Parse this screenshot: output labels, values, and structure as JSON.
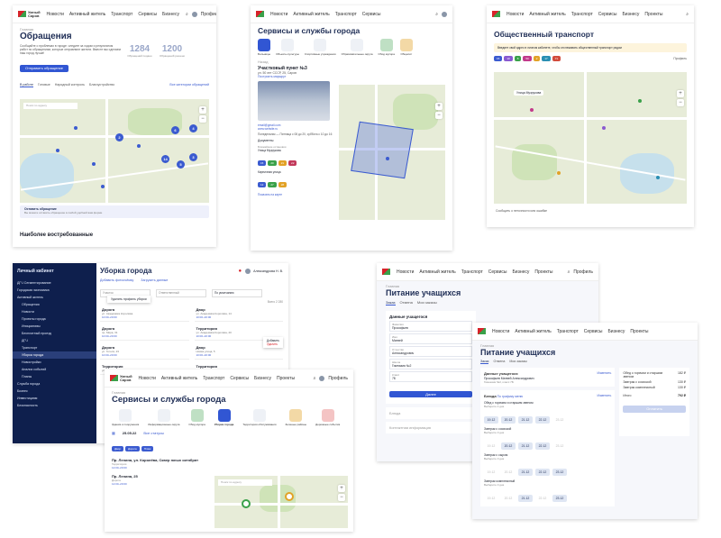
{
  "logo": {
    "line1": "Умный",
    "line2": "Саров"
  },
  "nav": {
    "news": "Новости",
    "active": "Активный житель",
    "transport": "Транспорт",
    "services": "Сервисы",
    "business": "Бизнесу",
    "projects": "Проекты",
    "profile": "Профиль",
    "home": "Главная"
  },
  "obr": {
    "title": "Обращения",
    "desc": "Сообщайте о проблемах в городе: следите за ходом и результатом работ по обращениям, которые отправляют жители. Вместе мы сделаем наш город лучше!",
    "count1": "1284",
    "count1_lbl": "Обращений подано",
    "count2": "1200",
    "count2_lbl": "Обращений решено",
    "send": "Отправить обращение",
    "tabs": [
      "В работе",
      "Готовые",
      "Народный контроль",
      "Благоустройство"
    ],
    "all": "Все категории обращений",
    "search": "Поиск по адресу",
    "popular": "Наиболее востребованные",
    "banner": "Оставить обращение",
    "banner_sub": "Вы можете оставить обращение в любой удобной вам форме",
    "clusters": [
      "2",
      "6",
      "3",
      "5",
      "14",
      "4"
    ]
  },
  "svc": {
    "title": "Сервисы и службы города",
    "tiles": [
      "Больницы",
      "Объекты культуры",
      "Спортивные учреждения",
      "Образовательные округа",
      "Обод мусора",
      "Общепит"
    ],
    "back": "Назад",
    "unit": "Участковый пункт №3",
    "addr": "ул. 50 лет СССР, 25, Саров",
    "route": "Построить маршрут",
    "email": "email@gmail.com",
    "site": "www.website.ru",
    "hours": "Понедельник — Пятница с 08 до 20, суббота с 10 до 16",
    "docs": "Документы",
    "lines": "Ближайшие остановки",
    "stop1": "Улица Музрукова",
    "stop2": "Кирпичная улица",
    "show": "Показать на карте",
    "chips1": [
      "15",
      "20",
      "21",
      "22"
    ],
    "chips2": [
      "12",
      "27",
      "28"
    ]
  },
  "tr": {
    "title": "Общественный транспорт",
    "notice": "Введите свой адрес в личном кабинете, чтобы отслеживать общественный транспорт рядом",
    "profile": "Профиль",
    "routes": [
      "15",
      "10",
      "8",
      "50",
      "2",
      "17",
      "71"
    ],
    "label": "Улица Музрукова",
    "footer": "Сообщить о неточности или ошибке"
  },
  "lk": {
    "title": "Личный кабинет",
    "section": "Уборка города",
    "items": [
      "ДГЧ Сегментирование",
      "Городская экономика",
      "Активный житель",
      "Обращения",
      "Новости",
      "Проекты города",
      "Инициативы",
      "Бесплатный проезд",
      "ДГЧ",
      "Транспорт",
      "Уборка города",
      "Новостройки",
      "Анализ событий",
      "Планы",
      "Служба города",
      "Бизнес",
      "Инвестициям",
      "Безопасность"
    ],
    "add": "Добавить фотосъёмку",
    "load": "Загрузить данные",
    "user": "Александрова Н. В.",
    "menu_item": "Удалить профиль уборки",
    "filter1": "Участок",
    "filter2": "Ответственный",
    "filter3": "Последовательность",
    "sort": "По умолчанию",
    "list": [
      "Дорога",
      "Двор",
      "Дорога",
      "Территория",
      "Дорога",
      "Двор",
      "Территория",
      "Территория"
    ],
    "addrs": [
      "ул. Академика Королёва",
      "ул. Академика Королёва, 14",
      "пр. Мира, 31",
      "ул. Академика Королёва, 20",
      "ул. Гоголя, 23",
      "Новая улица, 5",
      "ул. Зернова, 2",
      "пр. Ленина, 22"
    ],
    "time": "10:00–20:00",
    "edit": "Добавить",
    "del": "Удалить",
    "total": "Всего 2 280"
  },
  "pit1": {
    "title": "Питание учащихся",
    "tabs": [
      "Заказ",
      "Отмена",
      "Мои заказы"
    ],
    "data": "Данные учащегося",
    "fields": [
      {
        "l": "Фамилия",
        "v": "Прокофьев"
      },
      {
        "l": "Имя",
        "v": "Матвей"
      },
      {
        "l": "Отчество",
        "v": "Александрович"
      },
      {
        "l": "Школа",
        "v": "Гимназия №2"
      },
      {
        "l": "Класс",
        "v": "7Б"
      }
    ],
    "next": "Далее",
    "block": "Блюда",
    "contact": "Контактная информация"
  },
  "pit2": {
    "title": "Питание учащихся",
    "tabs": [
      "Заказ",
      "Отмена",
      "Мои заказы"
    ],
    "data": "Данные учащегося",
    "change": "Изменить",
    "name": "Прокофьев Матвей Александрович",
    "school": "Гимназия №2, класс 7Б",
    "block": "Блюда",
    "plan": "По графику меню",
    "meals": [
      {
        "n": "Обед с горячим и старшим звеном",
        "s": "Выберите 4 дня"
      },
      {
        "n": "Завтрак с сосиской",
        "s": "Выберите 3 дня"
      },
      {
        "n": "Завтрак с сыром",
        "s": "Выберите 3 дня"
      },
      {
        "n": "Завтрак комплексный",
        "s": "Выберите 3 дня"
      }
    ],
    "dates": [
      "19.12",
      "20.12",
      "21.12",
      "22.12",
      "23.12"
    ],
    "sum": [
      {
        "n": "Обед с горячим и старшим звеном",
        "p": "182 ₽"
      },
      {
        "n": "Завтрак с сосиской",
        "p": "130 ₽"
      },
      {
        "n": "Завтрак комплексный",
        "p": "130 ₽"
      }
    ],
    "total_l": "Итого",
    "total": "792 ₽",
    "pay": "Оплатить"
  },
  "svc2": {
    "title": "Сервисы и службы города",
    "tiles": [
      "Здания и сооружения",
      "Информационные округа",
      "Обод мусора",
      "Уборка города",
      "Территория обслуживания",
      "Зеленые районы",
      "Дорожные события"
    ],
    "date": "25.05.22",
    "status": "Все статусы",
    "tags": [
      "Двор",
      "Дорога",
      "Пляж"
    ],
    "i1": "Пр. Ленина, ул. Королёва, Сквер юных октябрят",
    "i1t": "Территория",
    "i1h": "12:00–20:00",
    "i2": "Пр. Ленина, 25",
    "i2t": "Дорога",
    "i2h": "12:00–20:00",
    "search": "Поиск по адресу"
  }
}
